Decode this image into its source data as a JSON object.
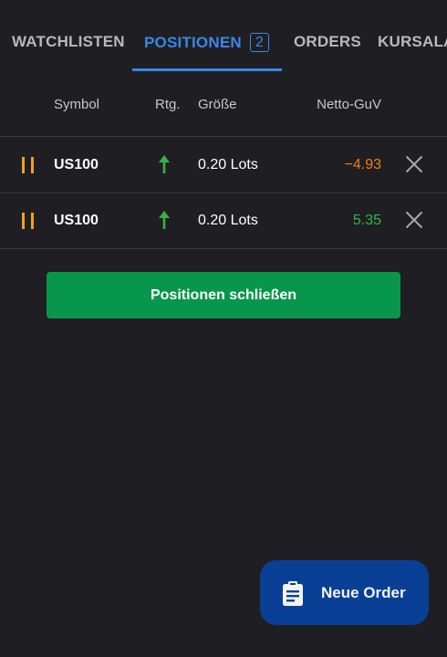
{
  "tabs": [
    {
      "label": "WATCHLISTEN",
      "active": false
    },
    {
      "label": "POSITIONEN",
      "active": true,
      "badge": "2"
    },
    {
      "label": "ORDERS",
      "active": false
    },
    {
      "label": "KURSALA",
      "active": false
    }
  ],
  "table": {
    "headers": {
      "symbol": "Symbol",
      "direction": "Rtg.",
      "size": "Größe",
      "pnl": "Netto-GuV"
    },
    "rows": [
      {
        "symbol": "US100",
        "direction": "up",
        "size": "0.20 Lots",
        "pnl": "−4.93",
        "pnl_sign": "negative"
      },
      {
        "symbol": "US100",
        "direction": "up",
        "size": "0.20 Lots",
        "pnl": "5.35",
        "pnl_sign": "positive"
      }
    ]
  },
  "actions": {
    "close_all_label": "Positionen schließen",
    "new_order_label": "Neue Order"
  },
  "colors": {
    "background": "#1f1f23",
    "accent": "#3a86e6",
    "negative": "#f07d1c",
    "positive": "#36b24a",
    "button_green": "#08964a",
    "fab_blue": "#0a3f96"
  }
}
